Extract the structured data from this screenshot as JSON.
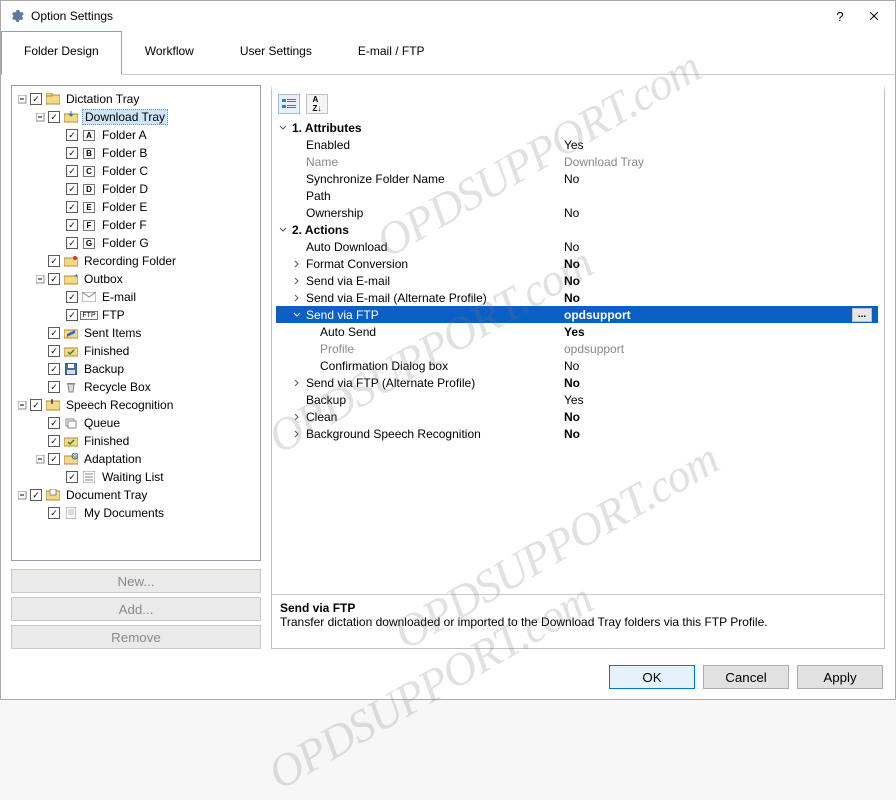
{
  "window": {
    "title": "Option Settings"
  },
  "tabs": [
    "Folder Design",
    "Workflow",
    "User Settings",
    "E-mail / FTP"
  ],
  "tree": [
    {
      "d": 0,
      "exp": "minus",
      "chk": true,
      "icon": "folder-tray",
      "label": "Dictation Tray"
    },
    {
      "d": 1,
      "exp": "minus",
      "chk": true,
      "icon": "download-folder",
      "label": "Download Tray",
      "sel": true
    },
    {
      "d": 2,
      "exp": "none",
      "chk": true,
      "icon": "letter-a",
      "label": "Folder A"
    },
    {
      "d": 2,
      "exp": "none",
      "chk": true,
      "icon": "letter-b",
      "label": "Folder B"
    },
    {
      "d": 2,
      "exp": "none",
      "chk": true,
      "icon": "letter-c",
      "label": "Folder C"
    },
    {
      "d": 2,
      "exp": "none",
      "chk": true,
      "icon": "letter-d",
      "label": "Folder D"
    },
    {
      "d": 2,
      "exp": "none",
      "chk": true,
      "icon": "letter-e",
      "label": "Folder E"
    },
    {
      "d": 2,
      "exp": "none",
      "chk": true,
      "icon": "letter-f",
      "label": "Folder F"
    },
    {
      "d": 2,
      "exp": "none",
      "chk": true,
      "icon": "letter-g",
      "label": "Folder G"
    },
    {
      "d": 1,
      "exp": "none",
      "chk": true,
      "icon": "record-folder",
      "label": "Recording Folder"
    },
    {
      "d": 1,
      "exp": "minus",
      "chk": true,
      "icon": "outbox",
      "label": "Outbox"
    },
    {
      "d": 2,
      "exp": "none",
      "chk": true,
      "icon": "envelope",
      "label": "E-mail"
    },
    {
      "d": 2,
      "exp": "none",
      "chk": true,
      "icon": "ftp",
      "label": "FTP"
    },
    {
      "d": 1,
      "exp": "none",
      "chk": true,
      "icon": "sent",
      "label": "Sent Items"
    },
    {
      "d": 1,
      "exp": "none",
      "chk": true,
      "icon": "check-folder",
      "label": "Finished"
    },
    {
      "d": 1,
      "exp": "none",
      "chk": true,
      "icon": "disk",
      "label": "Backup"
    },
    {
      "d": 1,
      "exp": "none",
      "chk": true,
      "icon": "recycle",
      "label": "Recycle Box"
    },
    {
      "d": 0,
      "exp": "minus",
      "chk": true,
      "icon": "speech",
      "label": "Speech Recognition"
    },
    {
      "d": 1,
      "exp": "none",
      "chk": true,
      "icon": "queue",
      "label": "Queue"
    },
    {
      "d": 1,
      "exp": "none",
      "chk": true,
      "icon": "check-folder",
      "label": "Finished"
    },
    {
      "d": 1,
      "exp": "minus",
      "chk": true,
      "icon": "adapt",
      "label": "Adaptation"
    },
    {
      "d": 2,
      "exp": "none",
      "chk": true,
      "icon": "list",
      "label": "Waiting List"
    },
    {
      "d": 0,
      "exp": "minus",
      "chk": true,
      "icon": "doc-tray",
      "label": "Document Tray"
    },
    {
      "d": 1,
      "exp": "none",
      "chk": true,
      "icon": "page",
      "label": "My Documents"
    }
  ],
  "leftButtons": {
    "new": "New...",
    "add": "Add...",
    "remove": "Remove"
  },
  "properties": [
    {
      "t": "cat",
      "exp": "open",
      "name": "1. Attributes"
    },
    {
      "t": "row",
      "ind": 1,
      "name": "Enabled",
      "val": "Yes"
    },
    {
      "t": "row",
      "ind": 1,
      "name": "Name",
      "val": "Download Tray",
      "gray": true
    },
    {
      "t": "row",
      "ind": 1,
      "name": "Synchronize Folder Name",
      "val": "No"
    },
    {
      "t": "row",
      "ind": 1,
      "name": "Path",
      "val": ""
    },
    {
      "t": "row",
      "ind": 1,
      "name": "Ownership",
      "val": "No"
    },
    {
      "t": "cat",
      "exp": "open",
      "name": "2. Actions"
    },
    {
      "t": "row",
      "ind": 1,
      "name": "Auto Download",
      "val": "No"
    },
    {
      "t": "row",
      "ind": 1,
      "exp": "closed",
      "name": "Format Conversion",
      "val": "No",
      "bold": true
    },
    {
      "t": "row",
      "ind": 1,
      "exp": "closed",
      "name": "Send via E-mail",
      "val": "No",
      "bold": true
    },
    {
      "t": "row",
      "ind": 1,
      "exp": "closed",
      "name": "Send via E-mail (Alternate Profile)",
      "val": "No",
      "bold": true
    },
    {
      "t": "row",
      "ind": 1,
      "exp": "open",
      "name": "Send via FTP",
      "val": "opdsupport",
      "bold": true,
      "sel": true,
      "elips": true
    },
    {
      "t": "row",
      "ind": 2,
      "name": "Auto Send",
      "val": "Yes",
      "bold": true
    },
    {
      "t": "row",
      "ind": 2,
      "name": "Profile",
      "val": "opdsupport",
      "gray": true
    },
    {
      "t": "row",
      "ind": 2,
      "name": "Confirmation Dialog box",
      "val": "No"
    },
    {
      "t": "row",
      "ind": 1,
      "exp": "closed",
      "name": "Send via FTP (Alternate Profile)",
      "val": "No",
      "bold": true
    },
    {
      "t": "row",
      "ind": 1,
      "name": "Backup",
      "val": "Yes"
    },
    {
      "t": "row",
      "ind": 1,
      "exp": "closed",
      "name": "Clean",
      "val": "No",
      "bold": true
    },
    {
      "t": "row",
      "ind": 1,
      "exp": "closed",
      "name": "Background Speech Recognition",
      "val": "No",
      "bold": true
    }
  ],
  "desc": {
    "title": "Send via FTP",
    "body": "Transfer dictation downloaded or imported to the Download Tray folders via this FTP Profile."
  },
  "bottom": {
    "ok": "OK",
    "cancel": "Cancel",
    "apply": "Apply"
  },
  "watermark": "OPDSUPPORT.com"
}
